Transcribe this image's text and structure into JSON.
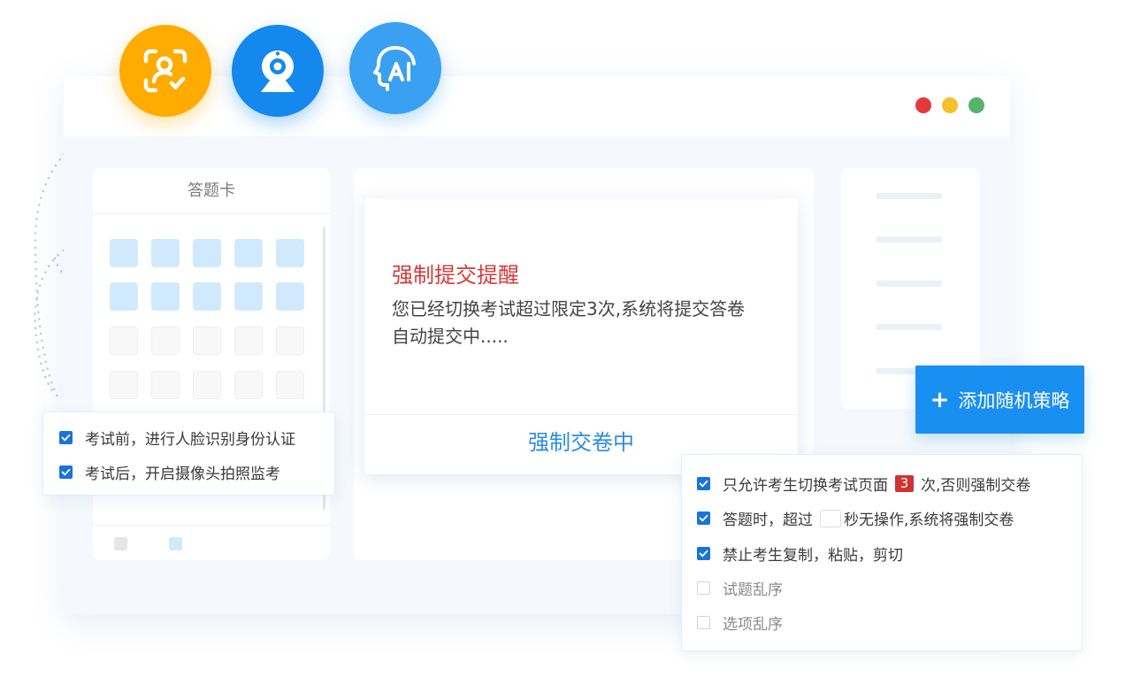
{
  "window": {
    "controls": {
      "close_color": "#e23a3a",
      "minimize_color": "#f3c028",
      "maximize_color": "#55b46a"
    }
  },
  "feature_icons": [
    {
      "icon": "face-recognition-icon",
      "color": "#ffab00"
    },
    {
      "icon": "webcam-icon",
      "color": "#1488ed"
    },
    {
      "icon": "ai-head-icon",
      "color": "#3aa0f1"
    }
  ],
  "answer_card": {
    "title": "答题卡",
    "answered_rows": 2,
    "unanswered_rows": 2,
    "columns": 5
  },
  "dialog": {
    "title": "强制提交提醒",
    "message_line1": "您已经切换考试超过限定3次,系统将提交答卷",
    "message_line2": "自动提交中.....",
    "action_label": "强制交卷中"
  },
  "add_button": {
    "icon": "plus-icon",
    "label": "添加随机策略"
  },
  "left_checklist": [
    {
      "label": "考试前，进行人脸识别身份认证",
      "checked": true
    },
    {
      "label": "考试后，开启摄像头拍照监考",
      "checked": true
    }
  ],
  "right_checklist": {
    "switch_limit": {
      "label_before": "只允许考生切换考试页面",
      "count": "3",
      "label_after": "次,否则强制交卷",
      "checked": true
    },
    "idle_timeout": {
      "label_before": "答题时，超过",
      "seconds_value": "",
      "label_after": "秒无操作,系统将强制交卷",
      "checked": true
    },
    "no_copy": {
      "label": "禁止考生复制，粘贴，剪切",
      "checked": true
    },
    "shuffle_questions": {
      "label": "试题乱序",
      "checked": false
    },
    "shuffle_options": {
      "label": "选项乱序",
      "checked": false
    }
  },
  "colors": {
    "primary": "#1a8ff2",
    "alert_red": "#d63a3a",
    "checkbox_blue": "#1a73d9"
  }
}
